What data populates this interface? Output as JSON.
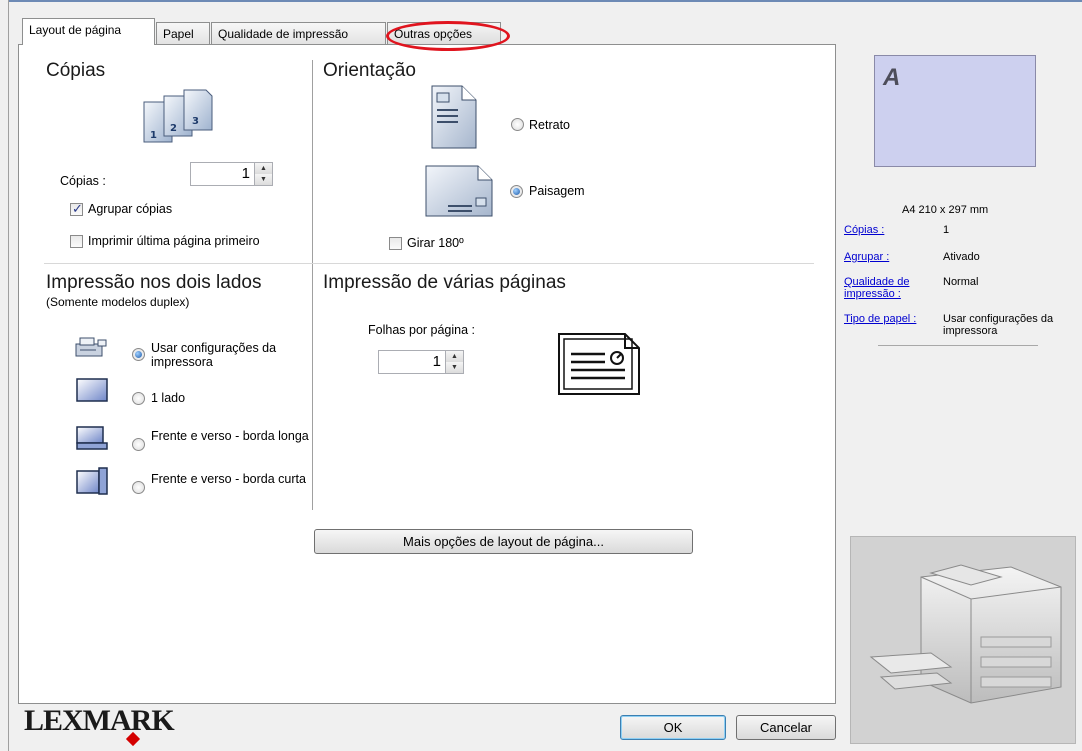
{
  "tabs": [
    {
      "label": "Layout de página"
    },
    {
      "label": "Papel"
    },
    {
      "label": "Qualidade de impressão"
    },
    {
      "label": "Outras opções"
    }
  ],
  "copies": {
    "title": "Cópias",
    "copies_label": "Cópias :",
    "copies_value": "1",
    "collate_label": "Agrupar cópias",
    "collate_checked": true,
    "reverse_label": "Imprimir última página primeiro",
    "reverse_checked": false
  },
  "orientation": {
    "title": "Orientação",
    "portrait_label": "Retrato",
    "landscape_label": "Paisagem",
    "selected": "landscape",
    "rotate_label": "Girar 180º",
    "rotate_checked": false
  },
  "duplex": {
    "title": "Impressão nos dois lados",
    "subtitle": "(Somente modelos duplex)",
    "options": [
      {
        "label": "Usar configurações da impressora",
        "selected": true
      },
      {
        "label": "1 lado",
        "selected": false
      },
      {
        "label": "Frente e verso - borda longa",
        "selected": false
      },
      {
        "label": "Frente e verso - borda curta",
        "selected": false
      }
    ]
  },
  "nup": {
    "title": "Impressão de várias páginas",
    "pages_label": "Folhas por página :",
    "pages_value": "1"
  },
  "more_button": "Mais opções de layout de página...",
  "preview": {
    "letter": "A",
    "paper": "A4 210 x 297 mm"
  },
  "summary": [
    {
      "key": "Cópias :",
      "value": "1"
    },
    {
      "key": "Agrupar :",
      "value": "Ativado"
    },
    {
      "key": "Qualidade de impressão :",
      "value": "Normal"
    },
    {
      "key": "Tipo de papel :",
      "value": "Usar configurações da impressora"
    }
  ],
  "brand": "LEXMARK",
  "ok_button": "OK",
  "cancel_button": "Cancelar",
  "colors": {
    "accent": "#1e5aa8",
    "highlight_ring": "#e0141e",
    "brand_red": "#d40000",
    "preview_fill": "#cdd0ef"
  }
}
